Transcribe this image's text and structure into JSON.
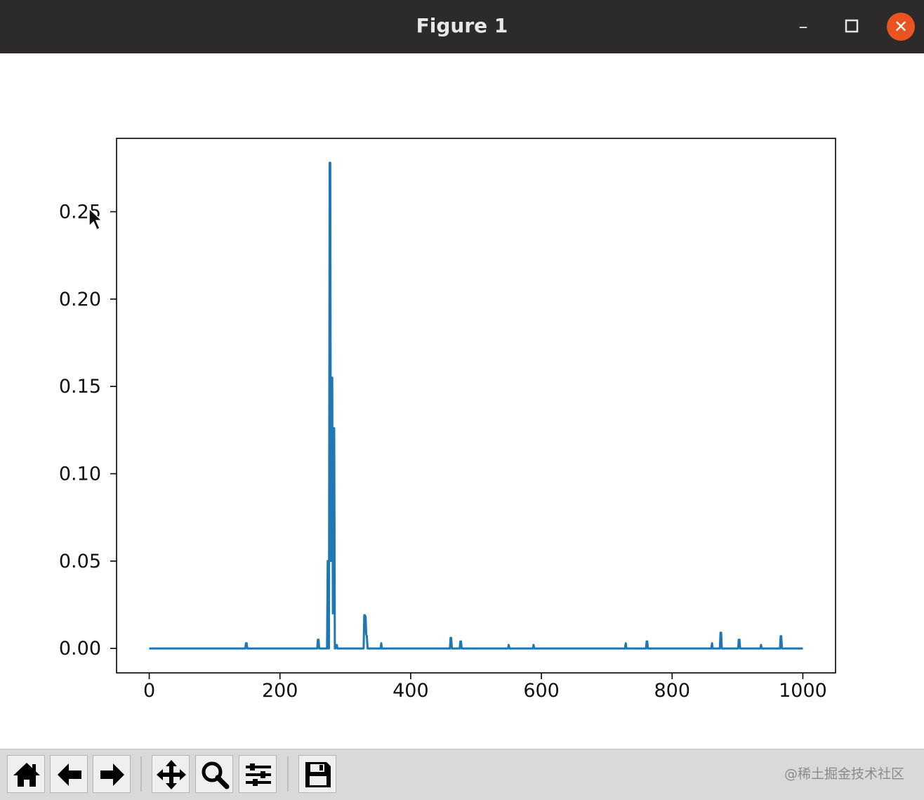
{
  "window": {
    "title": "Figure 1"
  },
  "toolbar": {
    "buttons": [
      {
        "name": "home-button",
        "icon": "home-icon"
      },
      {
        "name": "back-button",
        "icon": "arrow-left-icon"
      },
      {
        "name": "forward-button",
        "icon": "arrow-right-icon"
      },
      {
        "name": "pan-button",
        "icon": "move-icon"
      },
      {
        "name": "zoom-button",
        "icon": "magnifier-icon"
      },
      {
        "name": "configure-subplots-button",
        "icon": "sliders-icon"
      },
      {
        "name": "save-button",
        "icon": "floppy-disk-icon"
      }
    ]
  },
  "watermark": "@稀土掘金技术社区",
  "chart_data": {
    "type": "line",
    "title": "",
    "xlabel": "",
    "ylabel": "",
    "xlim": [
      -50,
      1050
    ],
    "ylim": [
      -0.014,
      0.292
    ],
    "xticks": [
      0,
      200,
      400,
      600,
      800,
      1000
    ],
    "xtick_labels": [
      "0",
      "200",
      "400",
      "600",
      "800",
      "1000"
    ],
    "yticks": [
      0.0,
      0.05,
      0.1,
      0.15,
      0.2,
      0.25
    ],
    "ytick_labels": [
      "0.00",
      "0.05",
      "0.10",
      "0.15",
      "0.20",
      "0.25"
    ],
    "grid": false,
    "color": "#1f77b4",
    "series": [
      {
        "x": [
          0,
          147,
          148,
          149,
          150,
          257,
          258,
          259,
          260,
          272,
          273,
          274,
          275,
          276,
          277,
          278,
          279,
          280,
          281,
          282,
          283,
          284,
          285,
          286,
          287,
          288,
          328,
          329,
          330,
          331,
          332,
          333,
          334,
          354,
          355,
          356,
          460,
          461,
          462,
          463,
          475,
          476,
          477,
          478,
          549,
          550,
          551,
          587,
          588,
          589,
          728,
          729,
          730,
          760,
          761,
          762,
          763,
          860,
          861,
          862,
          873,
          874,
          875,
          876,
          901,
          902,
          903,
          904,
          935,
          936,
          937,
          965,
          966,
          967,
          968,
          1000
        ],
        "y": [
          0,
          0,
          0.003,
          0.003,
          0,
          0,
          0.005,
          0.005,
          0,
          0,
          0.05,
          0.05,
          0,
          0.278,
          0.278,
          0.05,
          0.155,
          0.155,
          0.02,
          0.126,
          0.126,
          0,
          0,
          0.002,
          0.002,
          0,
          0,
          0.019,
          0.019,
          0.018,
          0.008,
          0.007,
          0,
          0,
          0.003,
          0,
          0,
          0.006,
          0.006,
          0,
          0,
          0.004,
          0.004,
          0,
          0,
          0.002,
          0,
          0,
          0.002,
          0,
          0,
          0.003,
          0,
          0,
          0.004,
          0.004,
          0,
          0,
          0.003,
          0,
          0,
          0.009,
          0.009,
          0,
          0,
          0.005,
          0.005,
          0,
          0,
          0.002,
          0,
          0,
          0.007,
          0.007,
          0,
          0
        ]
      }
    ]
  }
}
